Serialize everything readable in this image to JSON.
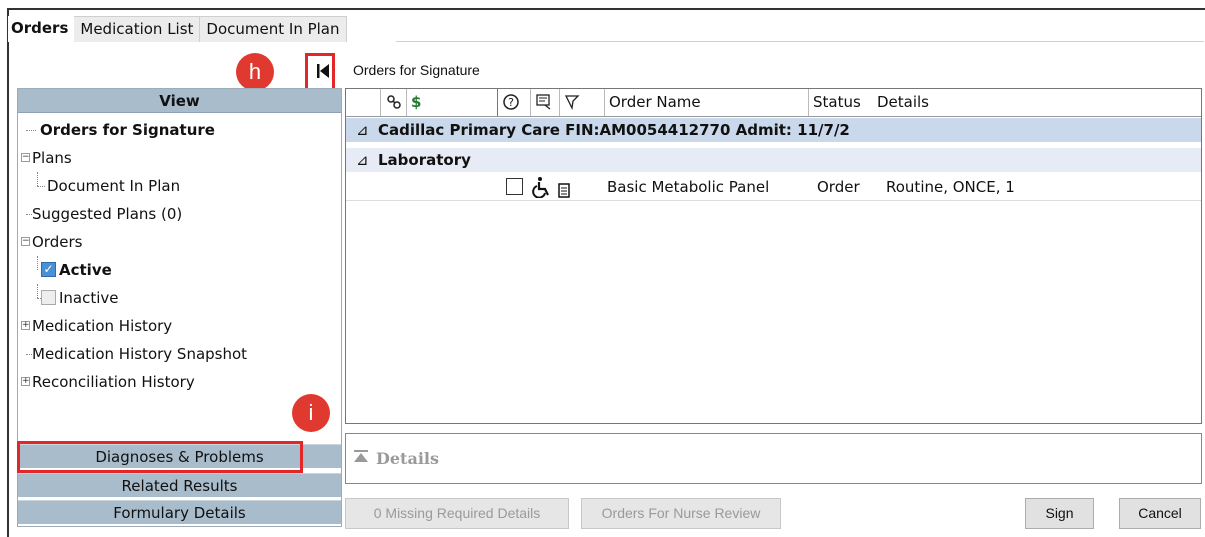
{
  "tabs": [
    {
      "label": "Orders"
    },
    {
      "label": "Medication List"
    },
    {
      "label": "Document In Plan"
    }
  ],
  "left_panel": {
    "header": "View",
    "tree": {
      "orders_for_signature": "Orders for Signature",
      "plans": "Plans",
      "document_in_plan": "Document In Plan",
      "suggested_plans": "Suggested Plans (0)",
      "orders": "Orders",
      "active": "Active",
      "inactive": "Inactive",
      "medication_history": "Medication History",
      "medication_history_snapshot": "Medication History Snapshot",
      "reconciliation_history": "Reconciliation History"
    },
    "bottom_bars": {
      "diagnoses": "Diagnoses & Problems",
      "related_results": "Related Results",
      "formulary_details": "Formulary Details"
    }
  },
  "annotations": {
    "h": "h",
    "i": "i",
    "color": "#e3262a"
  },
  "main": {
    "title": "Orders for Signature",
    "grid": {
      "columns": {
        "dollar": "$",
        "order_name": "Order Name",
        "status": "Status",
        "details": "Details"
      },
      "group1": "Cadillac Primary Care  FIN:AM0054412770  Admit: 11/7/2",
      "group2": "Laboratory",
      "rows": [
        {
          "order_name": "Basic Metabolic Panel",
          "status": "Order",
          "details": "Routine, ONCE, 1"
        }
      ]
    },
    "details_label": "Details",
    "buttons": {
      "missing": "0 Missing Required Details",
      "nurse_review": "Orders For Nurse Review",
      "sign": "Sign",
      "cancel": "Cancel"
    }
  }
}
